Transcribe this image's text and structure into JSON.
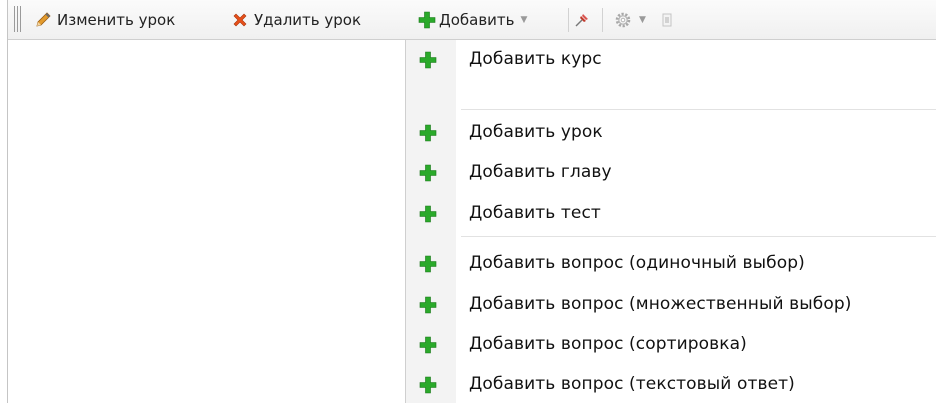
{
  "toolbar": {
    "edit_lesson": "Изменить урок",
    "delete_lesson": "Удалить урок",
    "add": "Добавить",
    "icons": [
      "grip-icon",
      "pencil-icon",
      "delete-x-icon",
      "plus-icon",
      "chevron-down-icon",
      "pin-icon",
      "gear-icon",
      "overflow-icon"
    ]
  },
  "menu": {
    "items": [
      {
        "label": "Добавить курс"
      },
      {
        "label": "Добавить урок"
      },
      {
        "label": "Добавить главу"
      },
      {
        "label": "Добавить тест"
      },
      {
        "label": "Добавить вопрос (одиночный выбор)"
      },
      {
        "label": "Добавить вопрос (множественный выбор)"
      },
      {
        "label": "Добавить вопрос (сортировка)"
      },
      {
        "label": "Добавить вопрос (текстовый ответ)"
      }
    ]
  },
  "colors": {
    "plus_green": "#2aa92a",
    "delete_orange": "#e8501a"
  }
}
